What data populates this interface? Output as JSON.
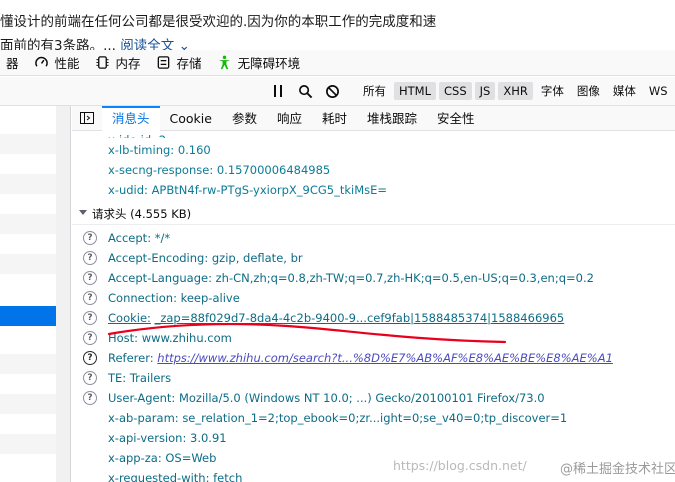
{
  "article": {
    "line1": "懂设计的前端在任何公司都是很受欢迎的.因为你的本职工作的完成度和速",
    "line2_text": "面前的有3条路。...",
    "readmore": "阅读全文",
    "readmore_icon": "chevron-down-icon"
  },
  "devtools_tabs": [
    {
      "label": "器",
      "icon": ""
    },
    {
      "label": "性能",
      "icon": "gauge-icon"
    },
    {
      "label": "内存",
      "icon": "memory-chip-icon"
    },
    {
      "label": "存储",
      "icon": "storage-icon"
    },
    {
      "label": "无障碍环境",
      "icon": "accessibility-icon"
    }
  ],
  "toolbar": {
    "icons": [
      "pause-icon",
      "search-icon",
      "block-icon"
    ],
    "filters": [
      {
        "label": "所有",
        "active": false
      },
      {
        "label": "HTML",
        "active": true
      },
      {
        "label": "CSS",
        "active": true
      },
      {
        "label": "JS",
        "active": true
      },
      {
        "label": "XHR",
        "active": true
      },
      {
        "label": "字体",
        "active": false
      },
      {
        "label": "图像",
        "active": false
      },
      {
        "label": "媒体",
        "active": false
      },
      {
        "label": "WS",
        "active": false
      }
    ]
  },
  "panel_tabs": [
    {
      "label": "消息头",
      "active": true
    },
    {
      "label": "Cookie",
      "active": false
    },
    {
      "label": "参数",
      "active": false
    },
    {
      "label": "响应",
      "active": false
    },
    {
      "label": "耗时",
      "active": false
    },
    {
      "label": "堆栈跟踪",
      "active": false
    },
    {
      "label": "安全性",
      "active": false
    }
  ],
  "response_headers": [
    {
      "text": "x-lb-timing: 0.160"
    },
    {
      "text": "x-secng-response: 0.15700006484985"
    },
    {
      "text": "x-udid: APBtN4f-rw-PTgS-yxiorpX_9CG5_tkiMsE="
    }
  ],
  "request_section": {
    "title": "请求头 (4.555 KB)"
  },
  "request_headers": [
    {
      "key": "Accept:",
      "value": "*/*"
    },
    {
      "key": "Accept-Encoding:",
      "value": "gzip, deflate, br"
    },
    {
      "key": "Accept-Language:",
      "value": "zh-CN,zh;q=0.8,zh-TW;q=0.7,zh-HK;q=0.5,en-US;q=0.3,en;q=0.2"
    },
    {
      "key": "Connection:",
      "value": "keep-alive"
    },
    {
      "key": "Cookie:",
      "value": "_zap=88f029d7-8da4-4c2b-9400-9...cef9fab|1588485374|1588466965"
    },
    {
      "key": "Host:",
      "value": "www.zhihu.com"
    },
    {
      "key": "Referer:",
      "value": "https://www.zhihu.com/search?t...%8D%E7%AB%AF%E8%AE%BE%E8%AE%A1"
    },
    {
      "key": "TE:",
      "value": "Trailers"
    },
    {
      "key": "User-Agent:",
      "value": "Mozilla/5.0 (Windows NT 10.0; ...) Gecko/20100101 Firefox/73.0"
    },
    {
      "key": "x-ab-param:",
      "value": "se_relation_1=2;top_ebook=0;zr...ight=0;se_v40=0;tp_discover=1"
    },
    {
      "key": "x-api-version:",
      "value": "3.0.91"
    },
    {
      "key": "x-app-za:",
      "value": "OS=Web"
    },
    {
      "key": "x-requested-with:",
      "value": "fetch"
    }
  ],
  "watermark": {
    "url": "https://blog.csdn.net/",
    "brand": "@稀土掘金技术社区"
  },
  "colors": {
    "accent": "#0a84ff",
    "selected_row": "#0074e8",
    "annotation": "#e8001c"
  }
}
